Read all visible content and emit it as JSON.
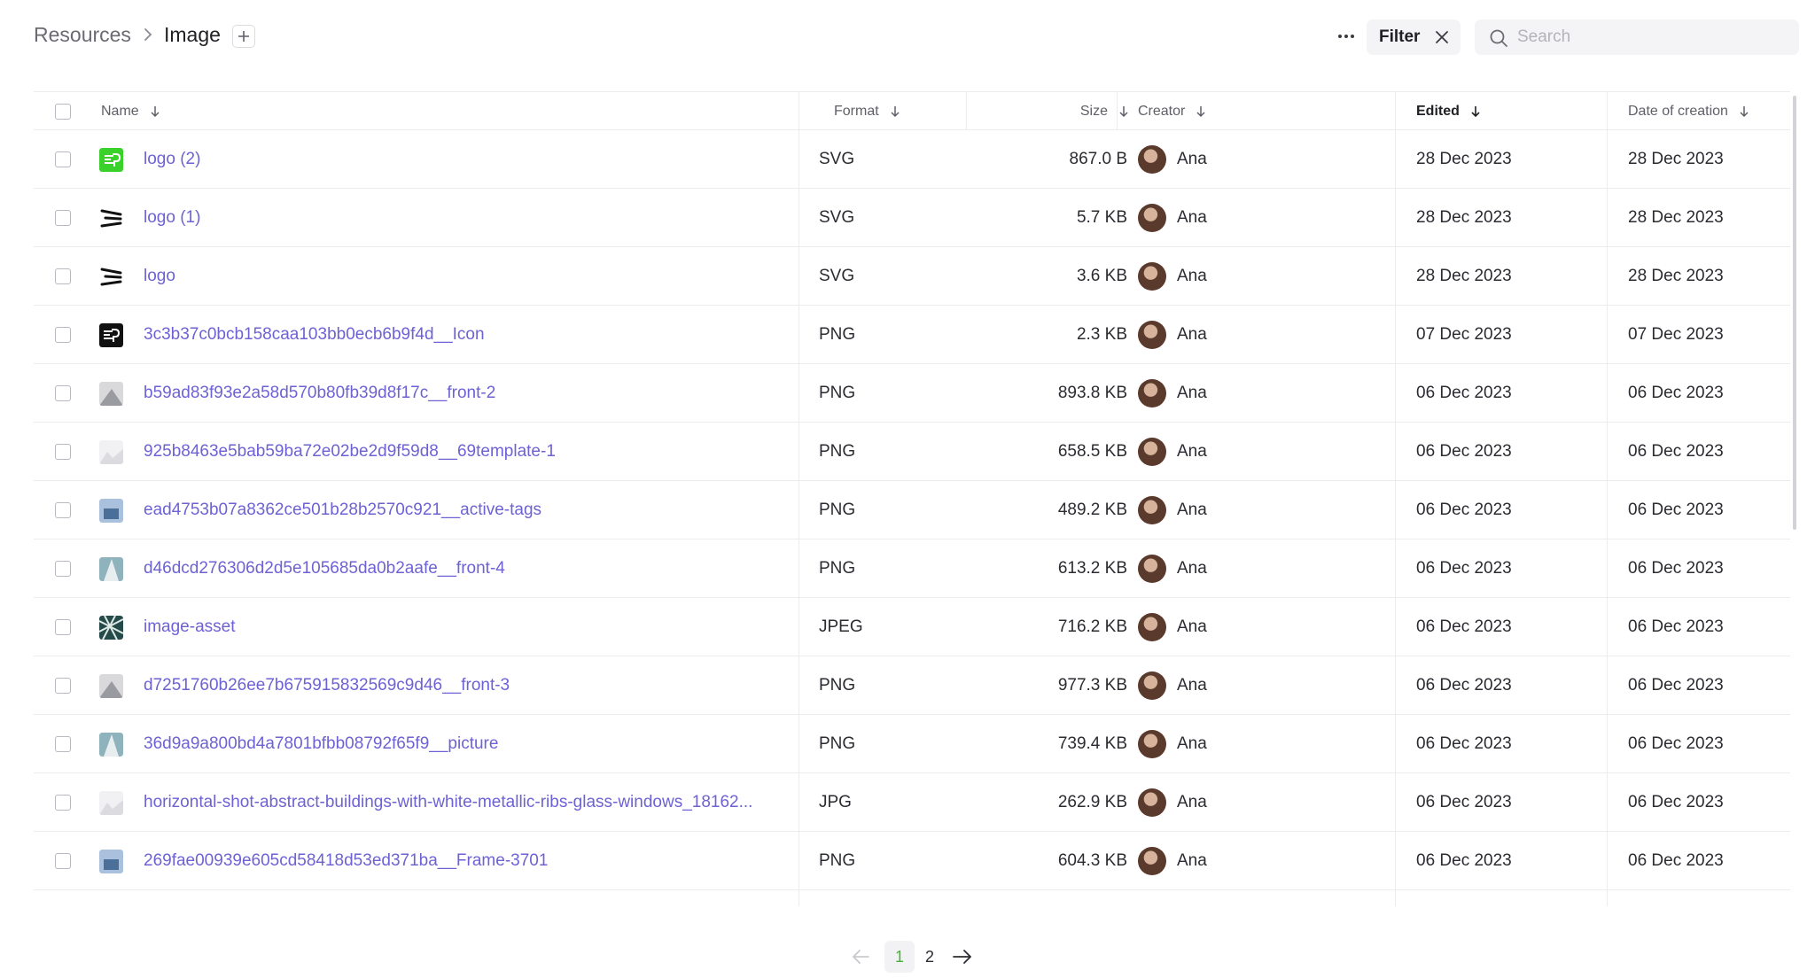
{
  "breadcrumb": {
    "root": "Resources",
    "current": "Image"
  },
  "toolbar": {
    "filter_label": "Filter",
    "search_placeholder": "Search"
  },
  "table": {
    "columns": [
      {
        "key": "name",
        "label": "Name"
      },
      {
        "key": "format",
        "label": "Format"
      },
      {
        "key": "size",
        "label": "Size"
      },
      {
        "key": "creator",
        "label": "Creator"
      },
      {
        "key": "edited",
        "label": "Edited",
        "active": true
      },
      {
        "key": "created",
        "label": "Date of creation"
      }
    ],
    "rows": [
      {
        "name": "logo (2)",
        "format": "SVG",
        "size": "867.0 B",
        "creator": "Ana",
        "edited": "28 Dec 2023",
        "created": "28 Dec 2023",
        "thumb": "green-logo"
      },
      {
        "name": "logo (1)",
        "format": "SVG",
        "size": "5.7 KB",
        "creator": "Ana",
        "edited": "28 Dec 2023",
        "created": "28 Dec 2023",
        "thumb": "stripes-logo"
      },
      {
        "name": "logo",
        "format": "SVG",
        "size": "3.6 KB",
        "creator": "Ana",
        "edited": "28 Dec 2023",
        "created": "28 Dec 2023",
        "thumb": "stripes-logo"
      },
      {
        "name": "3c3b37c0bcb158caa103bb0ecb6b9f4d__Icon",
        "format": "PNG",
        "size": "2.3 KB",
        "creator": "Ana",
        "edited": "07 Dec 2023",
        "created": "07 Dec 2023",
        "thumb": "black-logo"
      },
      {
        "name": "b59ad83f93e2a58d570b80fb39d8f17c__front-2",
        "format": "PNG",
        "size": "893.8 KB",
        "creator": "Ana",
        "edited": "06 Dec 2023",
        "created": "06 Dec 2023",
        "thumb": "grey-photo"
      },
      {
        "name": "925b8463e5bab59ba72e02be2d9f59d8__69template-1",
        "format": "PNG",
        "size": "658.5 KB",
        "creator": "Ana",
        "edited": "06 Dec 2023",
        "created": "06 Dec 2023",
        "thumb": "light-photo"
      },
      {
        "name": "ead4753b07a8362ce501b28b2570c921__active-tags",
        "format": "PNG",
        "size": "489.2 KB",
        "creator": "Ana",
        "edited": "06 Dec 2023",
        "created": "06 Dec 2023",
        "thumb": "blue-photo"
      },
      {
        "name": "d46dcd276306d2d5e105685da0b2aafe__front-4",
        "format": "PNG",
        "size": "613.2 KB",
        "creator": "Ana",
        "edited": "06 Dec 2023",
        "created": "06 Dec 2023",
        "thumb": "teal-photo"
      },
      {
        "name": "image-asset",
        "format": "JPEG",
        "size": "716.2 KB",
        "creator": "Ana",
        "edited": "06 Dec 2023",
        "created": "06 Dec 2023",
        "thumb": "pattern-photo"
      },
      {
        "name": "d7251760b26ee7b675915832569c9d46__front-3",
        "format": "PNG",
        "size": "977.3 KB",
        "creator": "Ana",
        "edited": "06 Dec 2023",
        "created": "06 Dec 2023",
        "thumb": "grey-photo"
      },
      {
        "name": "36d9a9a800bd4a7801bfbb08792f65f9__picture",
        "format": "PNG",
        "size": "739.4 KB",
        "creator": "Ana",
        "edited": "06 Dec 2023",
        "created": "06 Dec 2023",
        "thumb": "teal-photo"
      },
      {
        "name": "horizontal-shot-abstract-buildings-with-white-metallic-ribs-glass-windows_18162...",
        "format": "JPG",
        "size": "262.9 KB",
        "creator": "Ana",
        "edited": "06 Dec 2023",
        "created": "06 Dec 2023",
        "thumb": "light-photo"
      },
      {
        "name": "269fae00939e605cd58418d53ed371ba__Frame-3701",
        "format": "PNG",
        "size": "604.3 KB",
        "creator": "Ana",
        "edited": "06 Dec 2023",
        "created": "06 Dec 2023",
        "thumb": "blue-photo"
      }
    ]
  },
  "pagination": {
    "pages": [
      "1",
      "2"
    ],
    "current": "1"
  },
  "colors": {
    "link": "#6d62d4",
    "accent_green": "#44b437",
    "border": "#ececef"
  }
}
